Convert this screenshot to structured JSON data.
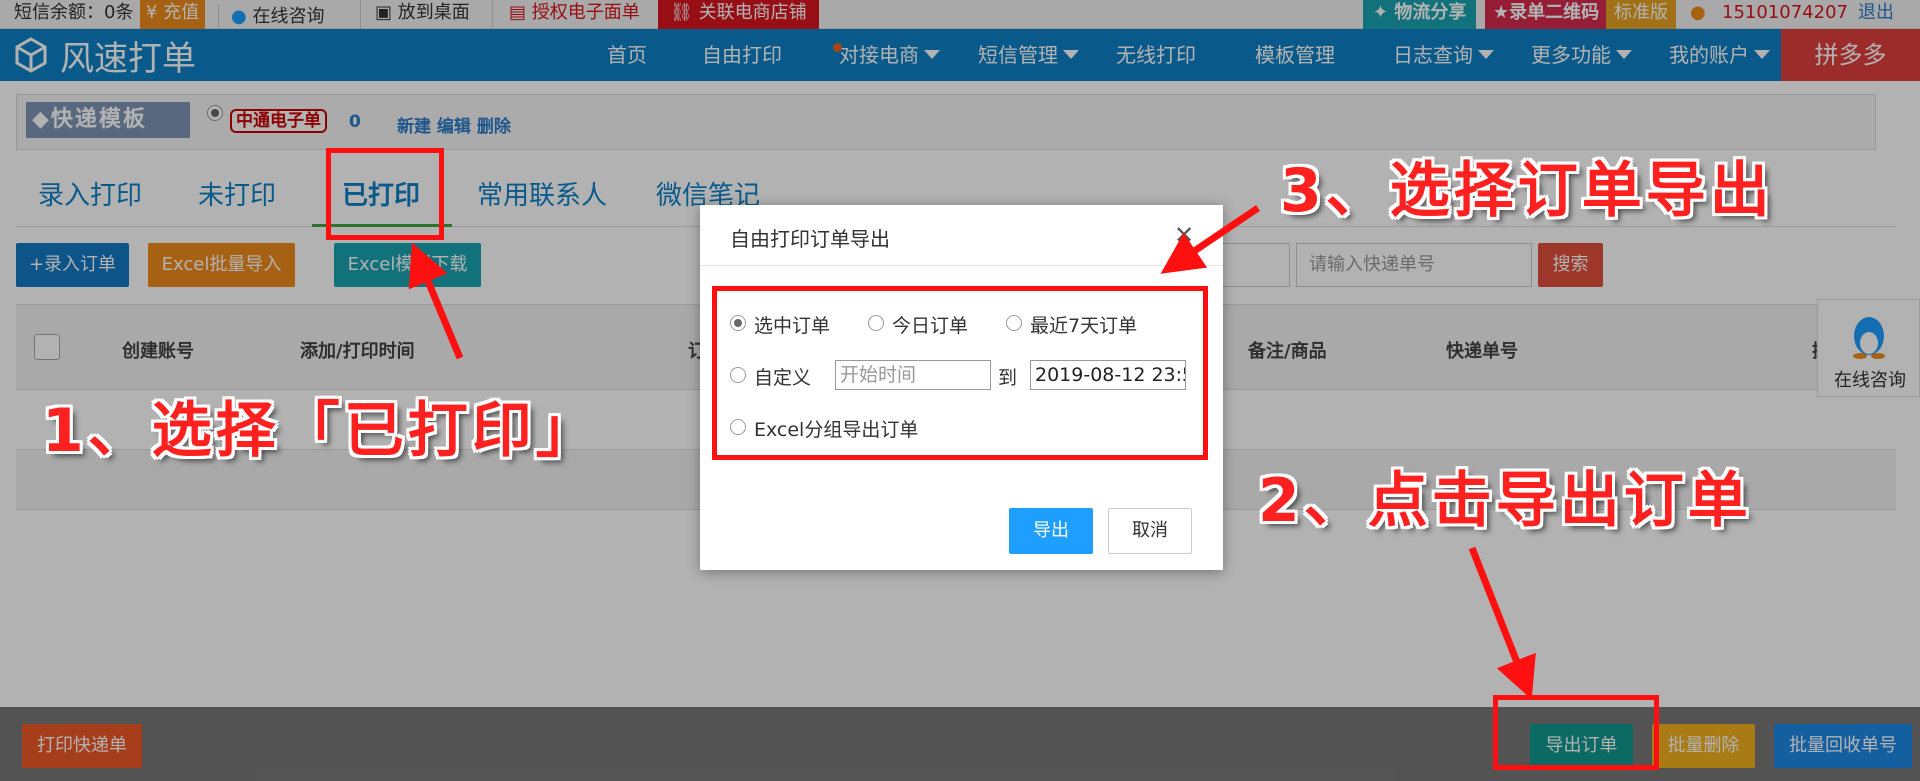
{
  "topbar": {
    "sms_balance": "短信余额：0条",
    "recharge": "充值",
    "online_chat": "在线咨询",
    "desktop": "放到桌面",
    "auth_e_sheet": "授权电子面单",
    "link_shop": "关联电商店铺",
    "logistics_share": "物流分享",
    "qr_entry": "录单二维码",
    "edition": "标准版",
    "phone": "15101074207",
    "logout": "退出"
  },
  "nav": {
    "brand": "风速打单",
    "items": [
      "首页",
      "自由打印",
      "对接电商",
      "短信管理",
      "无线打印",
      "模板管理",
      "日志查询",
      "更多功能",
      "我的账户"
    ],
    "pdd": "拼多多"
  },
  "template": {
    "title": "快递模板",
    "badge": "中通电子单",
    "count": "0",
    "actions": "新建 编辑 删除"
  },
  "tabs": [
    "录入打印",
    "未打印",
    "已打印",
    "常用联系人",
    "微信笔记"
  ],
  "actions": {
    "add_order": "+录入订单",
    "excel_import": "Excel批量导入",
    "excel_template": "Excel模板下载",
    "tracking_placeholder": "请输入快递单号",
    "search": "搜索"
  },
  "table": {
    "headers": [
      "创建账号",
      "添加/打印时间",
      "订",
      "备注/商品",
      "快递单号",
      "操"
    ]
  },
  "chat_float": "在线咨询",
  "footer": {
    "print_express": "打印快递单",
    "export_orders": "导出订单",
    "batch_delete": "批量删除",
    "batch_recycle": "批量回收单号"
  },
  "modal": {
    "title": "自由打印订单导出",
    "opt_selected": "选中订单",
    "opt_today": "今日订单",
    "opt_7days": "最近7天订单",
    "opt_custom": "自定义",
    "start_placeholder": "开始时间",
    "to": "到",
    "end_value": "2019-08-12 23:5",
    "opt_excel_group": "Excel分组导出订单",
    "export": "导出",
    "cancel": "取消"
  },
  "annotations": {
    "step1": "1、选择「已打印」",
    "step2": "2、点击导出订单",
    "step3": "3、选择订单导出"
  },
  "colors": {
    "nav_blue": "#0e82c6",
    "annotation_red": "#ff1010",
    "export_btn": "#1e9fff",
    "footer_green": "#11998e"
  }
}
